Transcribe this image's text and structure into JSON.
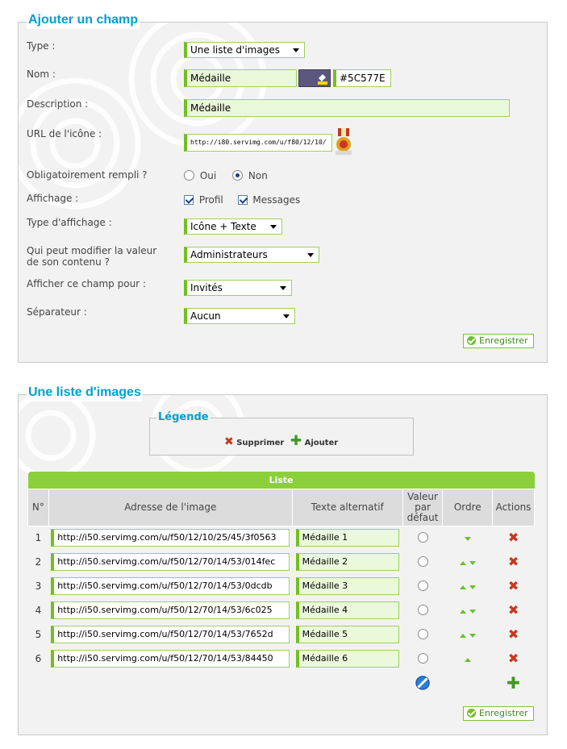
{
  "form": {
    "title": "Ajouter un champ",
    "type_label": "Type :",
    "type_value": "Une liste d'images",
    "nom_label": "Nom :",
    "nom_value": "Médaille",
    "color_value": "#5C577E",
    "color_swatch": "#5c577e",
    "description_label": "Description :",
    "description_value": "Médaille",
    "url_label": "URL de l'icône :",
    "url_value": "http://i80.servimg.com/u/f80/12/10/",
    "obligatoire_label": "Obligatoirement rempli ?",
    "oui_label": "Oui",
    "non_label": "Non",
    "obligatoire_selected": "Non",
    "affichage_label": "Affichage :",
    "profil_label": "Profil",
    "messages_label": "Messages",
    "type_affichage_label": "Type d'affichage :",
    "type_affichage_value": "Icône + Texte",
    "modifier_label_line1": "Qui peut modifier la valeur",
    "modifier_label_line2": "de son contenu ?",
    "modifier_value": "Administrateurs",
    "afficher_pour_label": "Afficher ce champ pour :",
    "afficher_pour_value": "Invités",
    "separateur_label": "Séparateur :",
    "separateur_value": "Aucun",
    "save_label": "Enregistrer"
  },
  "images_panel": {
    "title": "Une liste d'images",
    "legend_title": "Légende",
    "legend_delete": "Supprimer",
    "legend_add": "Ajouter",
    "table_caption": "Liste",
    "headers": {
      "num": "N°",
      "address": "Adresse de l'image",
      "alt": "Texte alternatif",
      "default_l1": "Valeur",
      "default_l2": "par",
      "default_l3": "défaut",
      "order": "Ordre",
      "actions": "Actions"
    },
    "rows": [
      {
        "num": "1",
        "url": "http://i50.servimg.com/u/f50/12/10/25/45/3f0563",
        "alt": "Médaille 1",
        "up": false,
        "down": true
      },
      {
        "num": "2",
        "url": "http://i50.servimg.com/u/f50/12/70/14/53/014fec",
        "alt": "Médaille 2",
        "up": true,
        "down": true
      },
      {
        "num": "3",
        "url": "http://i50.servimg.com/u/f50/12/70/14/53/0dcdb",
        "alt": "Médaille 3",
        "up": true,
        "down": true
      },
      {
        "num": "4",
        "url": "http://i50.servimg.com/u/f50/12/70/14/53/6c025",
        "alt": "Médaille 4",
        "up": true,
        "down": true
      },
      {
        "num": "5",
        "url": "http://i50.servimg.com/u/f50/12/70/14/53/7652d",
        "alt": "Médaille 5",
        "up": true,
        "down": true
      },
      {
        "num": "6",
        "url": "http://i50.servimg.com/u/f50/12/70/14/53/84450",
        "alt": "Médaille 6",
        "up": true,
        "down": false
      }
    ],
    "save_label": "Enregistrer"
  },
  "colors": {
    "title_blue": "#00a0d0",
    "accent_green": "#72c01f",
    "delete_red": "#c8381c"
  }
}
